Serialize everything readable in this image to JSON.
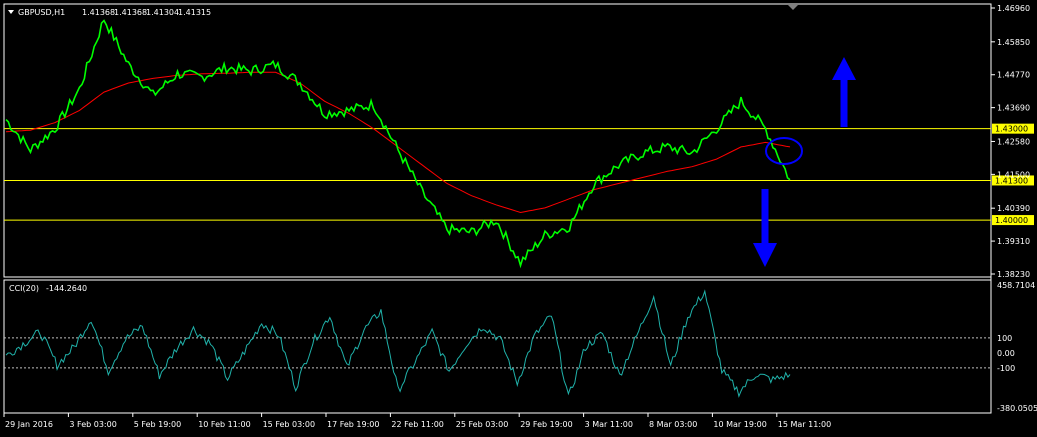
{
  "header": {
    "symbol_label": "GBPUSD,H1",
    "ohlc": [
      "1.41368",
      "1.41368",
      "1.41304",
      "1.41315"
    ]
  },
  "indicator": {
    "label": "CCI(20)",
    "value": "-144.2640"
  },
  "colors": {
    "background": "#000000",
    "frame": "#ffffff",
    "price": "#00ff00",
    "moving_average": "#ff0000",
    "levels": "#ffff00",
    "cci": "#20b2aa",
    "annotation": "#0000ff"
  },
  "chart_data": [
    {
      "type": "line",
      "title": "GBPUSD,H1",
      "ylim": [
        1.3823,
        1.4696
      ],
      "yticks": [
        "1.46960",
        "1.45850",
        "1.44770",
        "1.43690",
        "1.42580",
        "1.41500",
        "1.40390",
        "1.39310",
        "1.38230"
      ],
      "x_ticks": [
        "29 Jan 2016",
        "3 Feb 03:00",
        "5 Feb 19:00",
        "10 Feb 11:00",
        "15 Feb 03:00",
        "17 Feb 19:00",
        "22 Feb 11:00",
        "25 Feb 03:00",
        "29 Feb 19:00",
        "3 Mar 11:00",
        "8 Mar 03:00",
        "10 Mar 19:00",
        "15 Mar 11:00"
      ],
      "horizontal_levels": [
        "1.43000",
        "1.41300",
        "1.40000"
      ],
      "series": [
        {
          "role": "price",
          "x": [
            "29 Jan 2016",
            "1 Feb",
            "2 Feb",
            "3 Feb 03:00",
            "4 Feb",
            "5 Feb 19:00",
            "8 Feb",
            "9 Feb",
            "10 Feb 11:00",
            "11 Feb",
            "12 Feb",
            "15 Feb 03:00",
            "16 Feb",
            "17 Feb 19:00",
            "18 Feb",
            "19 Feb",
            "22 Feb 11:00",
            "23 Feb",
            "24 Feb",
            "25 Feb 03:00",
            "26 Feb",
            "29 Feb 19:00",
            "1 Mar",
            "2 Mar",
            "3 Mar 11:00",
            "4 Mar",
            "7 Mar",
            "8 Mar 03:00",
            "9 Mar",
            "10 Mar 19:00",
            "11 Mar",
            "14 Mar",
            "15 Mar 11:00"
          ],
          "values": [
            1.433,
            1.423,
            1.43,
            1.443,
            1.466,
            1.451,
            1.441,
            1.448,
            1.447,
            1.45,
            1.449,
            1.451,
            1.445,
            1.435,
            1.436,
            1.438,
            1.423,
            1.409,
            1.397,
            1.396,
            1.4,
            1.386,
            1.395,
            1.398,
            1.412,
            1.418,
            1.422,
            1.424,
            1.422,
            1.43,
            1.439,
            1.43,
            1.4132
          ]
        },
        {
          "role": "moving-average",
          "x": [
            "29 Jan 2016",
            "1 Feb",
            "2 Feb",
            "3 Feb 03:00",
            "4 Feb",
            "5 Feb 19:00",
            "8 Feb",
            "9 Feb",
            "10 Feb 11:00",
            "11 Feb",
            "12 Feb",
            "15 Feb 03:00",
            "16 Feb",
            "17 Feb 19:00",
            "18 Feb",
            "19 Feb",
            "22 Feb 11:00",
            "23 Feb",
            "24 Feb",
            "25 Feb 03:00",
            "26 Feb",
            "29 Feb 19:00",
            "1 Mar",
            "2 Mar",
            "3 Mar 11:00",
            "4 Mar",
            "7 Mar",
            "8 Mar 03:00",
            "9 Mar",
            "10 Mar 19:00",
            "11 Mar",
            "14 Mar",
            "15 Mar 11:00"
          ],
          "values": [
            1.429,
            1.4295,
            1.432,
            1.436,
            1.442,
            1.445,
            1.4465,
            1.4475,
            1.448,
            1.4482,
            1.4485,
            1.4485,
            1.445,
            1.439,
            1.435,
            1.43,
            1.424,
            1.418,
            1.412,
            1.408,
            1.405,
            1.4025,
            1.404,
            1.407,
            1.41,
            1.412,
            1.414,
            1.416,
            1.4175,
            1.42,
            1.424,
            1.4255,
            1.424
          ]
        }
      ]
    },
    {
      "type": "line",
      "title": "CCI(20) -144.2640",
      "ylim": [
        -380.05,
        458.7104
      ],
      "yticks": [
        "458.7104",
        "100",
        "0.00",
        "-100",
        "-380.0505"
      ],
      "levels": [
        100,
        -100
      ],
      "series": [
        {
          "role": "cci",
          "values": [
            -20,
            60,
            140,
            -80,
            40,
            230,
            -120,
            90,
            180,
            -150,
            30,
            160,
            60,
            -170,
            10,
            200,
            120,
            -230,
            70,
            250,
            -100,
            150,
            280,
            -250,
            -60,
            140,
            -120,
            60,
            180,
            90,
            -200,
            110,
            250,
            -300,
            40,
            130,
            -150,
            110,
            380,
            -90,
            240,
            410,
            -120,
            -260,
            -140,
            -180,
            -144
          ]
        }
      ]
    }
  ]
}
